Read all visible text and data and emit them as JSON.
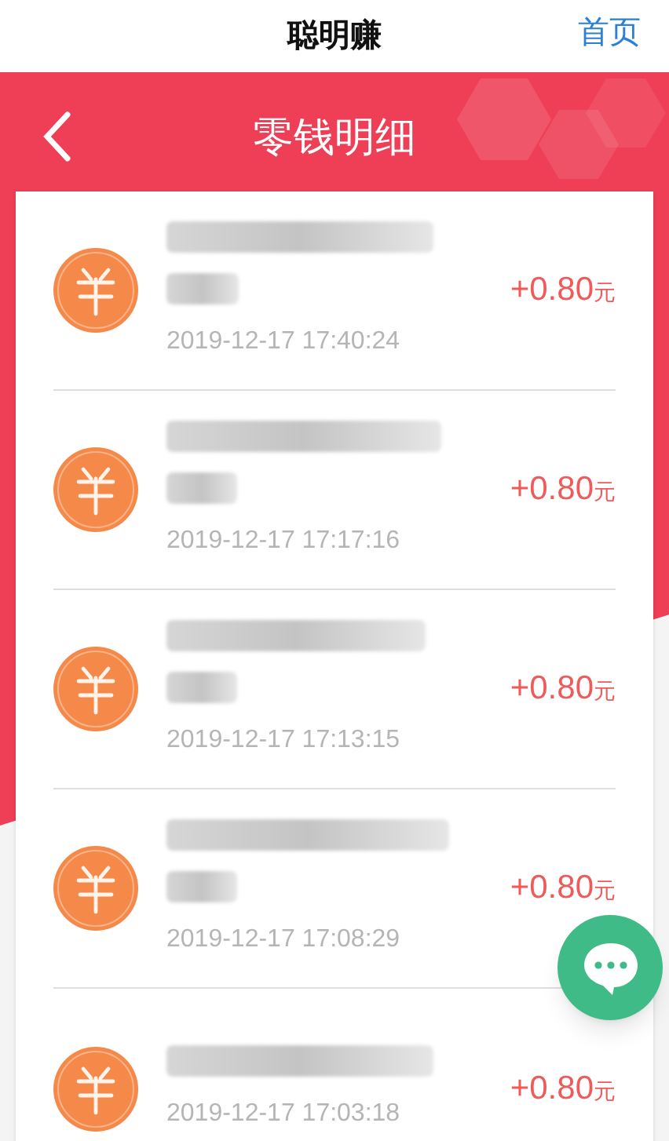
{
  "top_bar": {
    "title": "聪明赚",
    "home_link": "首页"
  },
  "header": {
    "title": "零钱明细"
  },
  "records": [
    {
      "time": "2019-12-17 17:40:24",
      "amount": "+0.80",
      "unit": "元"
    },
    {
      "time": "2019-12-17 17:17:16",
      "amount": "+0.80",
      "unit": "元"
    },
    {
      "time": "2019-12-17 17:13:15",
      "amount": "+0.80",
      "unit": "元"
    },
    {
      "time": "2019-12-17 17:08:29",
      "amount": "+0.80",
      "unit": "元"
    },
    {
      "time": "2019-12-17 17:03:18",
      "amount": "+0.80",
      "unit": "元"
    }
  ]
}
